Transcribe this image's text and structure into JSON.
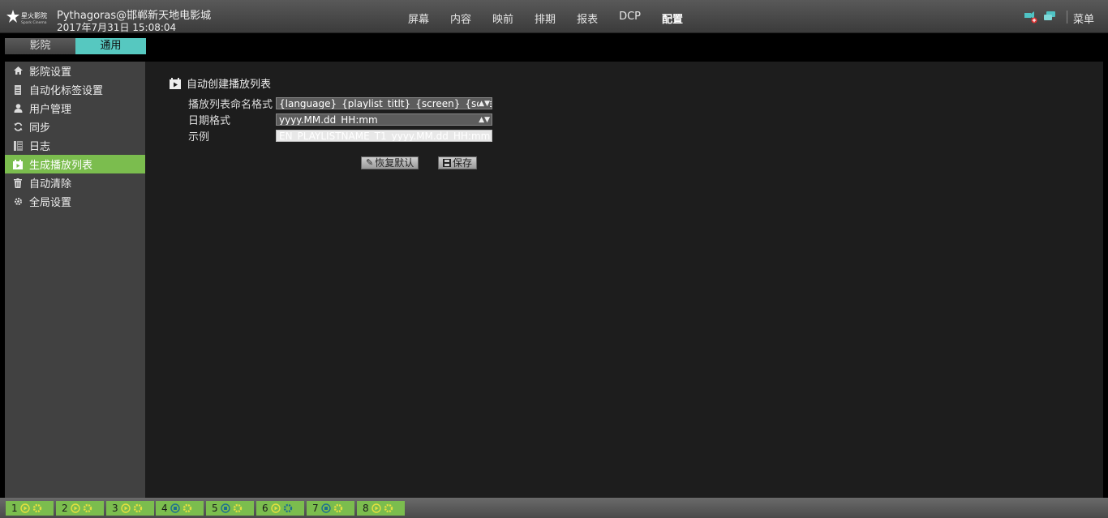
{
  "header": {
    "logo_text": "星火影院 Spark Cinema",
    "title": "Pythagoras@邯郸新天地电影城",
    "datetime": "2017年7月31日 15:08:04",
    "nav": [
      {
        "label": "屏幕"
      },
      {
        "label": "内容"
      },
      {
        "label": "映前"
      },
      {
        "label": "排期"
      },
      {
        "label": "报表"
      },
      {
        "label": "DCP"
      },
      {
        "label": "配置",
        "active": true
      }
    ],
    "menu_label": "菜单"
  },
  "subtabs": [
    {
      "label": "影院"
    },
    {
      "label": "通用",
      "active": true
    }
  ],
  "sidebar": {
    "items": [
      {
        "label": "影院设置",
        "icon": "home-icon"
      },
      {
        "label": "自动化标签设置",
        "icon": "tag-icon"
      },
      {
        "label": "用户管理",
        "icon": "user-icon"
      },
      {
        "label": "同步",
        "icon": "sync-icon"
      },
      {
        "label": "日志",
        "icon": "log-icon"
      },
      {
        "label": "生成播放列表",
        "icon": "playlist-icon",
        "active": true
      },
      {
        "label": "自动清除",
        "icon": "trash-icon"
      },
      {
        "label": "全局设置",
        "icon": "gear-icon"
      }
    ]
  },
  "main": {
    "section_title": "自动创建播放列表",
    "naming_label": "播放列表命名格式",
    "naming_value": "{language}_{playlist_titlt}_{screen}_{scheduled_p",
    "date_label": "日期格式",
    "date_value": "yyyy.MM.dd_HH:mm",
    "example_label": "示例",
    "example_value": "EN_PLAYLISTNAME_T1_yyyy.MM.dd_HH:mm",
    "reset_label": "恢复默认",
    "save_label": "保存"
  },
  "screens": [
    {
      "number": "1",
      "status": "play"
    },
    {
      "number": "2",
      "status": "play"
    },
    {
      "number": "3",
      "status": "play"
    },
    {
      "number": "4",
      "status": "stop"
    },
    {
      "number": "5",
      "status": "stop"
    },
    {
      "number": "6",
      "status": "play"
    },
    {
      "number": "7",
      "status": "stop"
    },
    {
      "number": "8",
      "status": "play"
    }
  ],
  "colors": {
    "accent_green": "#7bbd4e",
    "accent_teal": "#56c8c0"
  }
}
